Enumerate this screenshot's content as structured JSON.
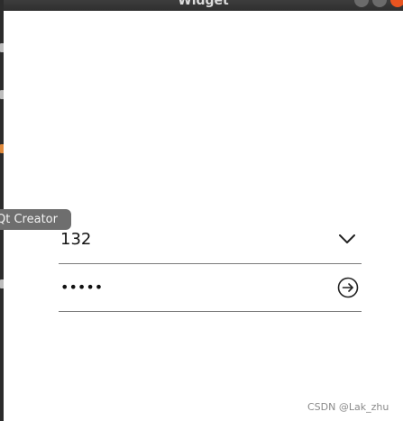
{
  "window": {
    "title": "Widget"
  },
  "tooltip": {
    "text": "Qt Creator"
  },
  "login": {
    "account_value": "132",
    "password_value": "•••••"
  },
  "icons": {
    "dropdown": "chevron-down-icon",
    "submit": "arrow-right-circle-icon"
  },
  "watermark": "CSDN @Lak_zhu",
  "colors": {
    "window_bg": "#ffffff",
    "field_underline": "#7a7a7a",
    "close_button": "#e95420",
    "tooltip_bg": "#6e6e6e"
  }
}
